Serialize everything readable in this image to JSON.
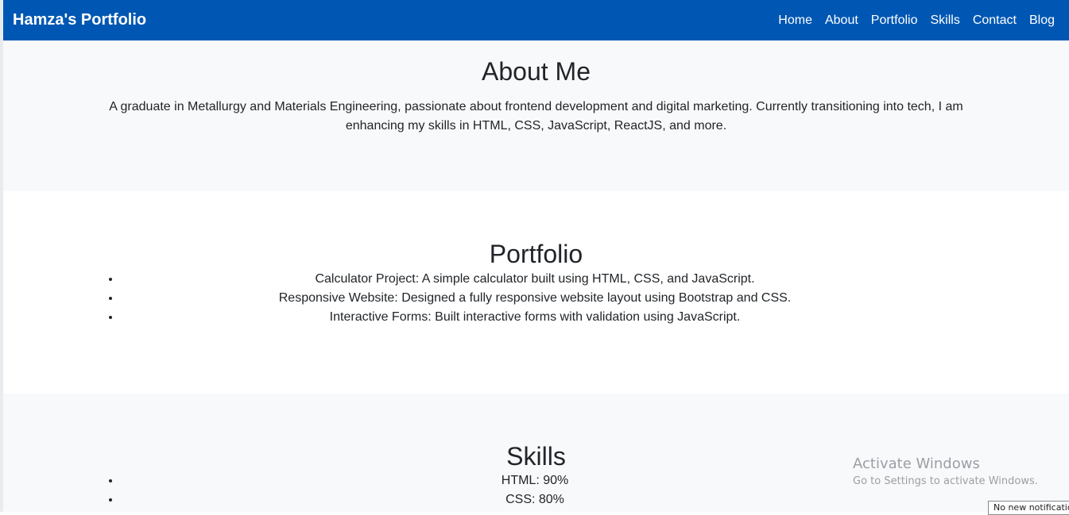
{
  "navbar": {
    "brand": "Hamza's Portfolio",
    "links": [
      "Home",
      "About",
      "Portfolio",
      "Skills",
      "Contact",
      "Blog"
    ],
    "background_color": "#0057b3"
  },
  "about": {
    "title": "About Me",
    "text": "A graduate in Metallurgy and Materials Engineering, passionate about frontend development and digital marketing. Currently transitioning into tech, I am enhancing my skills in HTML, CSS, JavaScript, ReactJS, and more."
  },
  "portfolio": {
    "title": "Portfolio",
    "items": [
      "Calculator Project: A simple calculator built using HTML, CSS, and JavaScript.",
      "Responsive Website: Designed a fully responsive website layout using Bootstrap and CSS.",
      "Interactive Forms: Built interactive forms with validation using JavaScript."
    ]
  },
  "skills": {
    "title": "Skills",
    "items": [
      "HTML: 90%",
      "CSS: 80%"
    ]
  },
  "os_overlay": {
    "watermark_title": "Activate Windows",
    "watermark_subtitle": "Go to Settings to activate Windows.",
    "notification": "No new notifications"
  }
}
